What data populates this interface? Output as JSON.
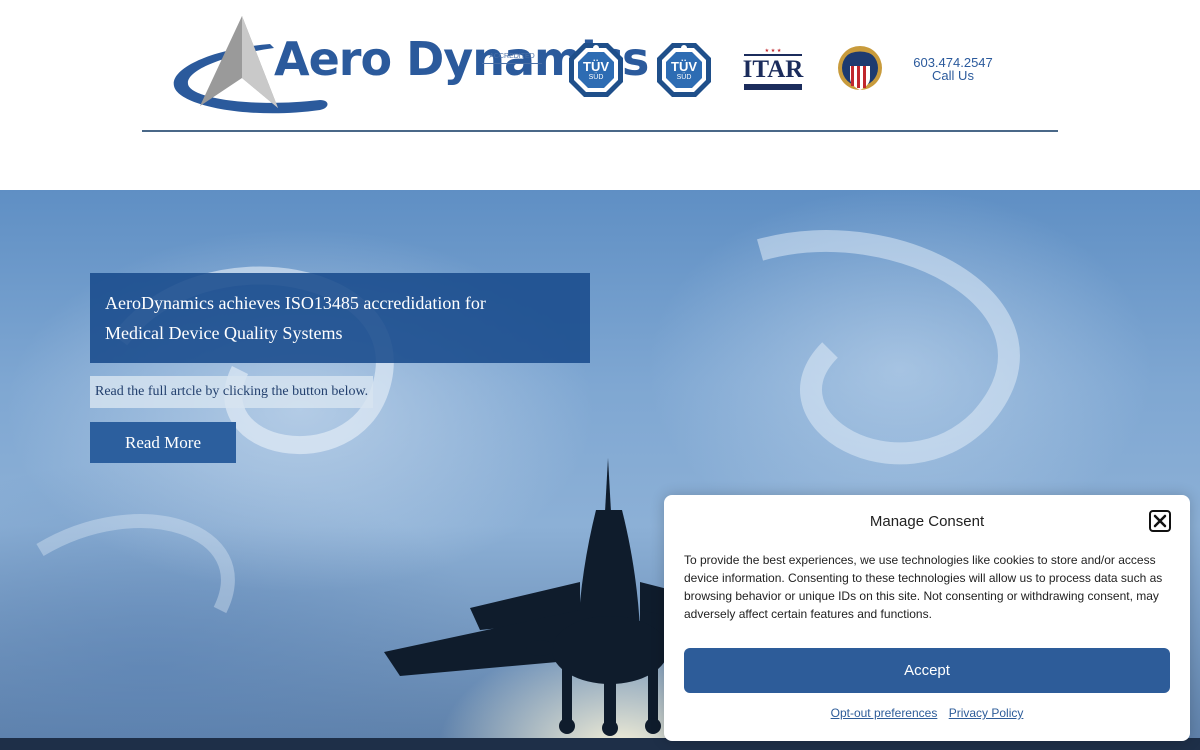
{
  "header": {
    "logo_text": "Aero Dynamics",
    "cert_overlay": "ACCREDITED",
    "badges": [
      {
        "name": "TÜV SÜD",
        "icon": "tuv-sud-badge-icon"
      },
      {
        "name": "TÜV SÜD",
        "icon": "tuv-sud-iso-badge-icon"
      },
      {
        "name": "ITAR",
        "icon": "itar-badge-icon"
      },
      {
        "name": "DLA",
        "icon": "dla-seal-icon"
      }
    ],
    "itar_text": "ITAR",
    "tuv_text": "TÜV",
    "sud_text": "SÜD",
    "phone": "603.474.2547",
    "call_label": "Call Us"
  },
  "hero": {
    "headline": "AeroDynamics achieves ISO13485 accredidation for Medical Device Quality Systems",
    "subnote": "Read the full artcle by clicking the button below.",
    "button_label": "Read More"
  },
  "consent": {
    "title": "Manage Consent",
    "body": "To provide the best experiences, we use technologies like cookies to store and/or access device information. Consenting to these technologies will allow us to process data such as browsing behavior or unique IDs on this site. Not consenting or withdrawing consent, may adversely affect certain features and functions.",
    "accept_label": "Accept",
    "opt_out_label": "Opt-out preferences",
    "privacy_label": "Privacy Policy"
  },
  "colors": {
    "brand_blue": "#2b5a9c",
    "button_blue": "#2d5c99",
    "headline_bg": "#194b8c"
  }
}
